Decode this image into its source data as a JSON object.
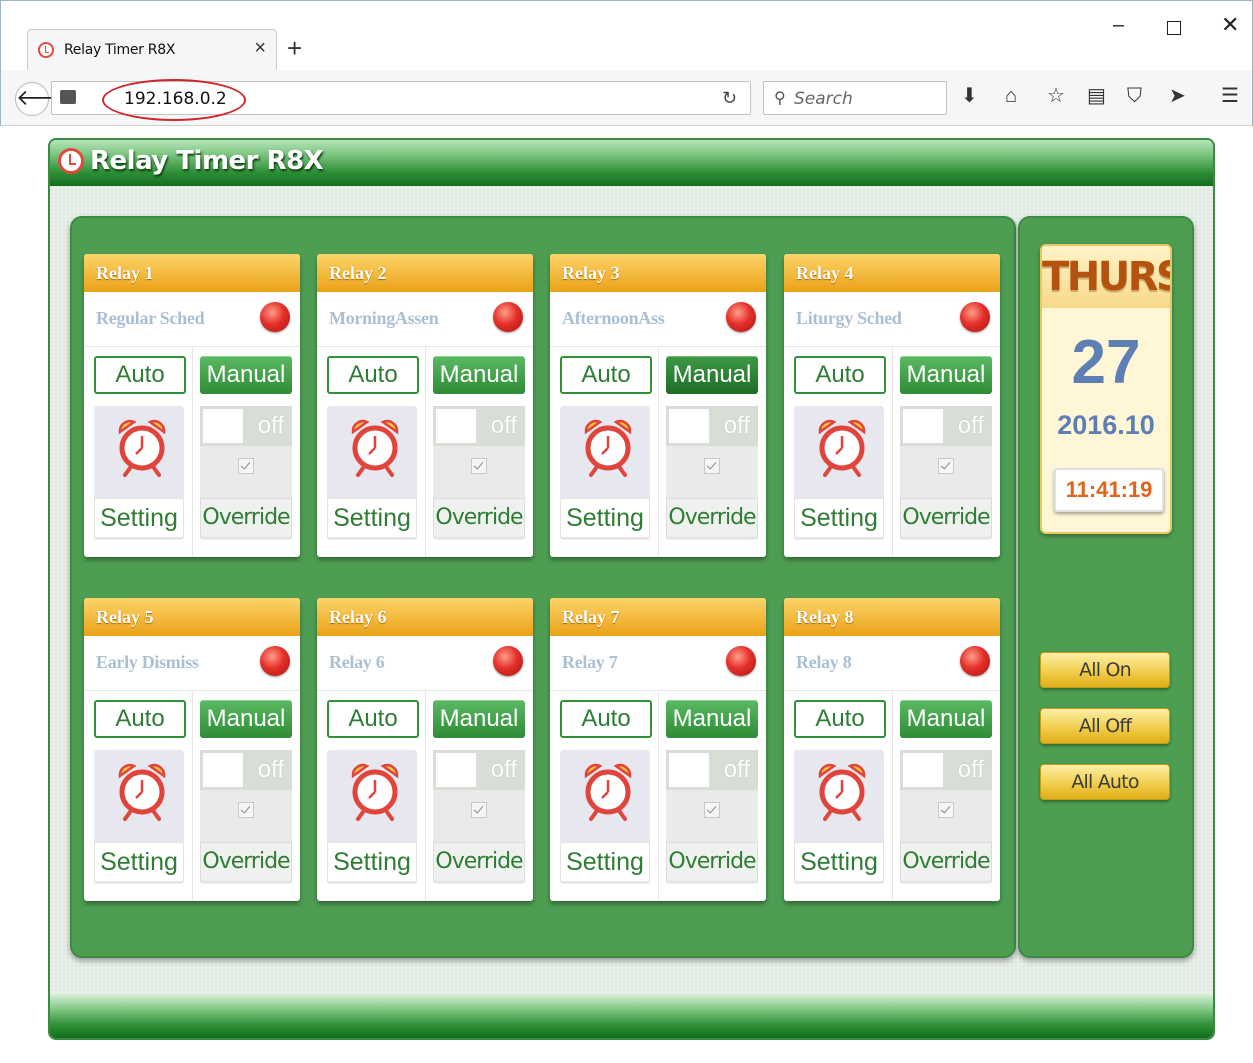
{
  "browser": {
    "tab_title": "Relay Timer R8X",
    "tab_close": "×",
    "new_tab": "+",
    "url": "192.168.0.2",
    "search_placeholder": "Search"
  },
  "app": {
    "title": "Relay Timer R8X"
  },
  "relays": [
    {
      "header": "Relay 1",
      "name": "Regular Sched",
      "auto_label": "Auto",
      "manual_label": "Manual",
      "toggle": "off",
      "setting_label": "Setting",
      "override_label": "Override"
    },
    {
      "header": "Relay 2",
      "name": "MorningAssen",
      "auto_label": "Auto",
      "manual_label": "Manual",
      "toggle": "off",
      "setting_label": "Setting",
      "override_label": "Override"
    },
    {
      "header": "Relay 3",
      "name": "AfternoonAss",
      "auto_label": "Auto",
      "manual_label": "Manual",
      "toggle": "off",
      "setting_label": "Setting",
      "override_label": "Override"
    },
    {
      "header": "Relay 4",
      "name": "Liturgy Sched",
      "auto_label": "Auto",
      "manual_label": "Manual",
      "toggle": "off",
      "setting_label": "Setting",
      "override_label": "Override"
    },
    {
      "header": "Relay 5",
      "name": "Early Dismiss",
      "auto_label": "Auto",
      "manual_label": "Manual",
      "toggle": "off",
      "setting_label": "Setting",
      "override_label": "Override"
    },
    {
      "header": "Relay 6",
      "name": "Relay 6",
      "auto_label": "Auto",
      "manual_label": "Manual",
      "toggle": "off",
      "setting_label": "Setting",
      "override_label": "Override"
    },
    {
      "header": "Relay 7",
      "name": "Relay 7",
      "auto_label": "Auto",
      "manual_label": "Manual",
      "toggle": "off",
      "setting_label": "Setting",
      "override_label": "Override"
    },
    {
      "header": "Relay 8",
      "name": "Relay 8",
      "auto_label": "Auto",
      "manual_label": "Manual",
      "toggle": "off",
      "setting_label": "Setting",
      "override_label": "Override"
    }
  ],
  "date": {
    "day_name": "THURS",
    "day": "27",
    "year_month": "2016.10",
    "time": "11:41:19"
  },
  "controls": {
    "all_on": "All On",
    "all_off": "All Off",
    "all_auto": "All Auto"
  },
  "colors": {
    "panel_green": "#4e9e52",
    "header_amber": "#eba218",
    "led_red": "#e5302a",
    "manual_green": "#2d8c35",
    "time_orange": "#e2641b"
  }
}
